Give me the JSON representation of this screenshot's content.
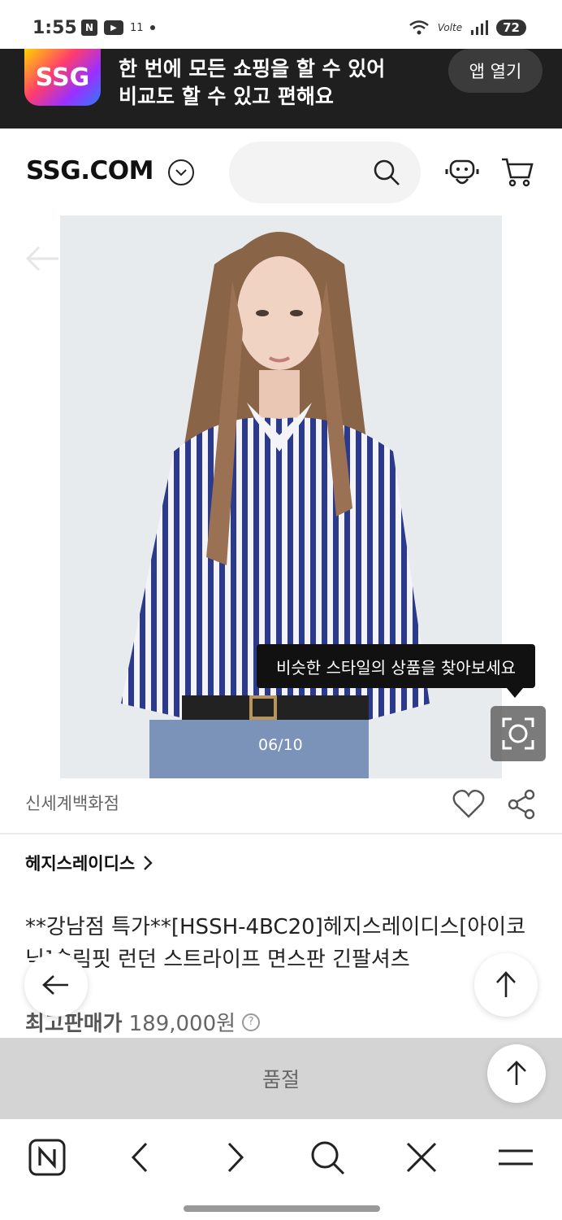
{
  "status_bar": {
    "time": "1:55",
    "notif_n": "N",
    "notif_extra": "11",
    "network": "Volte",
    "battery": "72"
  },
  "app_banner": {
    "logo_text": "SSG",
    "line1": "한 번에 모든 쇼핑을 할 수 있어",
    "line2": "비교도 할 수 있고 편해요",
    "open_button": "앱 열기"
  },
  "header": {
    "logo": "SSG.COM"
  },
  "product": {
    "image_counter": "06/10",
    "tooltip": "비슷한 스타일의 상품을 찾아보세요",
    "store": "신세계백화점",
    "brand": "헤지스레이디스",
    "title": "**강남점 특가**[HSSH-4BC20]헤지스레이디스[아이코닉]슬림핏 런던 스트라이프 면스판 긴팔셔츠",
    "price_label": "최고판매가",
    "price_value": "189,000원",
    "soldout": "품절"
  },
  "icons": {
    "search": "search-icon",
    "cs": "customer-service-icon",
    "cart": "cart-icon",
    "heart": "heart-icon",
    "share": "share-icon",
    "lens": "visual-search-icon"
  }
}
